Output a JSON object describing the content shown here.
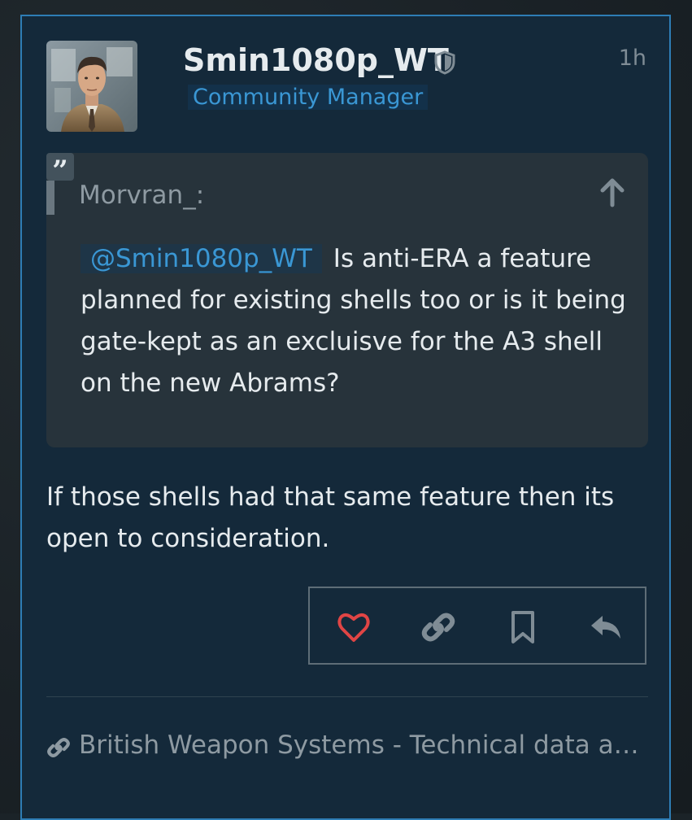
{
  "post": {
    "username": "Smin1080p_WT",
    "role": "Community Manager",
    "time": "1h",
    "quote": {
      "author": "Morvran_:",
      "mention": "@Smin1080p_WT",
      "text": "Is anti-ERA a feature planned for existing shells too or is it being gate-kept as an excluisve for the A3 shell on the new Abrams?"
    },
    "body": "If those shells had that same feature then its open to consideration.",
    "link": "British Weapon Systems - Technical data a…"
  },
  "icons": {
    "like": "heart-icon",
    "share": "link-icon",
    "bookmark": "bookmark-icon",
    "reply": "reply-icon",
    "moderator": "shield-icon",
    "quote": "quote-icon",
    "jump_up": "arrow-up-icon"
  },
  "colors": {
    "accent": "#3a97d4",
    "like": "#e04545",
    "card_bg": "#14293a",
    "quote_bg": "#27333b"
  }
}
